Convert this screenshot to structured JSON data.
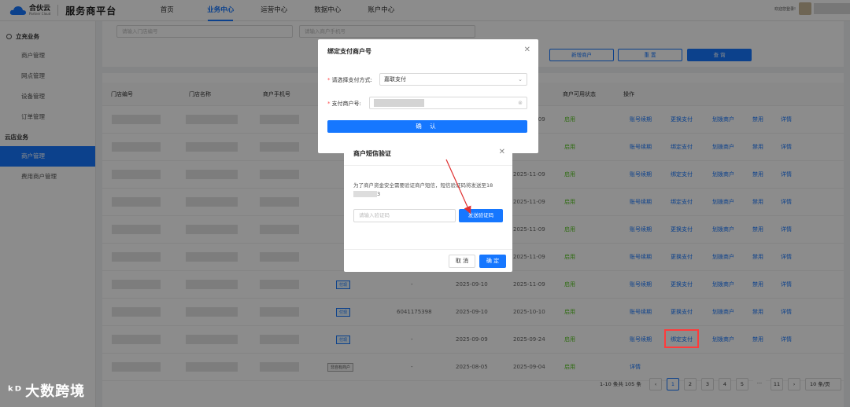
{
  "app": {
    "logo_cn": "合伙云",
    "logo_en": "Partner Cloud",
    "platform": "服务商平台",
    "nav": [
      "首页",
      "业务中心",
      "运营中心",
      "数据中心",
      "账户中心"
    ],
    "welcome": "欢迎您登录!"
  },
  "sidebar": {
    "groups": [
      {
        "label": "立充业务",
        "items": [
          "商户管理",
          "网点管理",
          "设备管理",
          "订单管理"
        ]
      },
      {
        "label": "云店业务",
        "items": [
          "商户管理",
          "费用商户管理"
        ]
      }
    ]
  },
  "filters": {
    "store_no_placeholder": "请输入门店编号",
    "phone_placeholder": "请输入商户手机号",
    "add_merchant": "新增商户",
    "reset": "重 置",
    "search": "查 询"
  },
  "table": {
    "headers": [
      "门店编号",
      "门店名称",
      "商户手机号",
      "商户可用状态",
      "操作"
    ],
    "rows": [
      {
        "tag": "",
        "code": "",
        "d1": "",
        "d2": "2025-11-09",
        "status": "启用",
        "actions": [
          "账号续期",
          "更换支付",
          "划拨商户",
          "禁用",
          "详情"
        ]
      },
      {
        "tag": "",
        "code": "",
        "d1": "",
        "d2": "",
        "status": "启用",
        "actions": [
          "账号续期",
          "绑定支付",
          "划拨商户",
          "禁用",
          "详情"
        ]
      },
      {
        "tag": "",
        "code": "",
        "d1": "",
        "d2": "2025-11-09",
        "status": "启用",
        "actions": [
          "账号续期",
          "绑定支付",
          "划拨商户",
          "禁用",
          "详情"
        ]
      },
      {
        "tag": "",
        "code": "",
        "d1": "",
        "d2": "2025-11-09",
        "status": "启用",
        "actions": [
          "账号续期",
          "绑定支付",
          "划拨商户",
          "禁用",
          "详情"
        ]
      },
      {
        "tag": "",
        "code": "",
        "d1": "",
        "d2": "2025-11-09",
        "status": "启用",
        "actions": [
          "账号续期",
          "更换支付",
          "划拨商户",
          "禁用",
          "详情"
        ]
      },
      {
        "tag": "",
        "code": "",
        "d1": "",
        "d2": "2025-11-09",
        "status": "启用",
        "actions": [
          "账号续期",
          "更换支付",
          "划拨商户",
          "禁用",
          "详情"
        ]
      },
      {
        "tag": "付现",
        "code": "-",
        "d1": "2025-09-10",
        "d2": "2025-11-09",
        "status": "启用",
        "actions": [
          "账号续期",
          "更换支付",
          "划拨商户",
          "禁用",
          "详情"
        ]
      },
      {
        "tag": "付现",
        "code": "6041175398",
        "d1": "2025-09-10",
        "d2": "2025-10-10",
        "status": "启用",
        "actions": [
          "账号续期",
          "更换支付",
          "划拨商户",
          "禁用",
          "详情"
        ]
      },
      {
        "tag": "付现",
        "code": "-",
        "d1": "2025-09-09",
        "d2": "2025-09-24",
        "status": "启用",
        "actions": [
          "账号续期",
          "绑定支付",
          "划拨商户",
          "禁用",
          "详情"
        ]
      },
      {
        "tag": "非自有商户",
        "code": "-",
        "d1": "2025-08-05",
        "d2": "2025-09-04",
        "status": "启用",
        "actions": [
          "详情"
        ]
      }
    ]
  },
  "pagination": {
    "total": "1-10 条共 105 条",
    "pages": [
      "1",
      "2",
      "3",
      "4",
      "5",
      "···",
      "11"
    ],
    "size": "10 条/页"
  },
  "modal_bind": {
    "title": "绑定支付商户号",
    "pay_method_label": "请选择支付方式:",
    "pay_method_value": "嘉联支付",
    "merchant_no_label": "支付商户号:",
    "confirm": "确 认"
  },
  "modal_sms": {
    "title": "商户短信验证",
    "desc": "为了商户资金安全需要验证商户短信，短信验证码将发送至18",
    "desc_tail": "3",
    "code_placeholder": "请输入验证码",
    "send": "发送验证码",
    "cancel": "取 消",
    "ok": "确 定"
  },
  "watermark": "大数跨境",
  "colors": {
    "primary": "#1677ff",
    "success": "#52c41a",
    "highlight": "#ff3b3b"
  }
}
